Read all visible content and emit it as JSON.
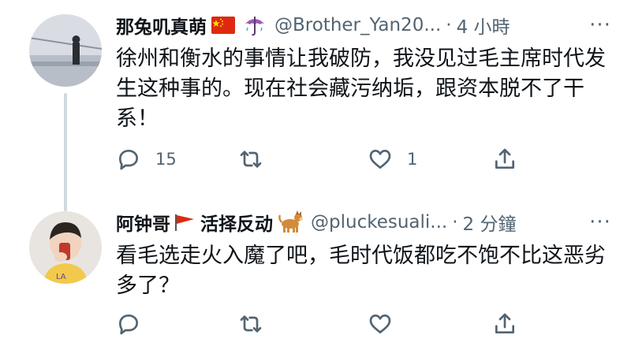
{
  "tweets": [
    {
      "display_name": "那兔叽真萌",
      "emojis": [
        "china-flag",
        "umbrella-rain"
      ],
      "handle": "@Brother_Yan20...",
      "dot": "·",
      "time": "4 小時",
      "text": "徐州和衡水的事情让我破防，我没见过毛主席时代发生这种事的。现在社会藏污纳垢，跟资本脱不了干系！",
      "reply_count": "15",
      "retweet_count": "",
      "like_count": "1",
      "more": "···"
    },
    {
      "display_name": "阿钟哥",
      "name_suffix": "活择反动",
      "emojis": [
        "triangular-flag",
        "dog"
      ],
      "handle": "@pluckesuali...",
      "dot": "·",
      "time": "2 分鐘",
      "text": "看毛选走火入魔了吧，毛时代饭都吃不饱不比这恶劣多了？",
      "reply_count": "",
      "retweet_count": "",
      "like_count": "",
      "more": "···"
    }
  ],
  "colors": {
    "text_primary": "#0f1419",
    "text_secondary": "#536471",
    "thread_line": "#cfd9de",
    "flag_red": "#de2910",
    "umbrella_purple": "#9b59b6"
  }
}
